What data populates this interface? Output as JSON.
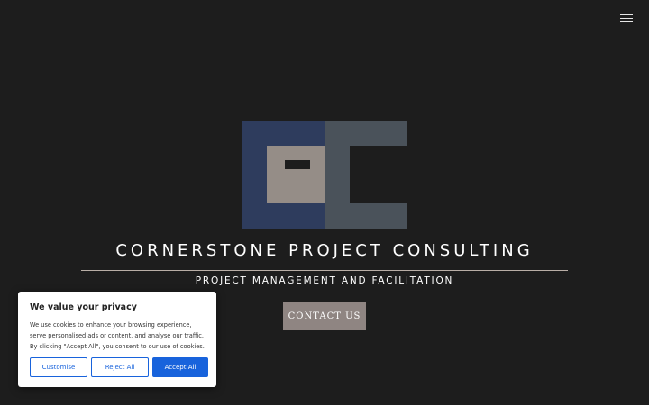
{
  "header": {
    "menu_icon": "hamburger-icon"
  },
  "logo": {
    "colors": {
      "navy": "#2e3c5d",
      "slate": "#4a525a",
      "taupe": "#958d87",
      "dark": "#1d1d1d"
    }
  },
  "hero": {
    "title": "CORNERSTONE PROJECT CONSULTING",
    "tagline": "PROJECT MANAGEMENT AND FACILITATION",
    "cta_label": "CONTACT US"
  },
  "cookie_banner": {
    "title": "We value your privacy",
    "text": "We use cookies to enhance your browsing experience, serve personalised ads or content, and analyse our traffic. By clicking \"Accept All\", you consent to our use of cookies.",
    "customise_label": "Customise",
    "reject_label": "Reject All",
    "accept_label": "Accept All"
  },
  "colors": {
    "background": "#1d1d1d",
    "accent_blue": "#1863dc",
    "button_taupe": "#8f8582"
  }
}
